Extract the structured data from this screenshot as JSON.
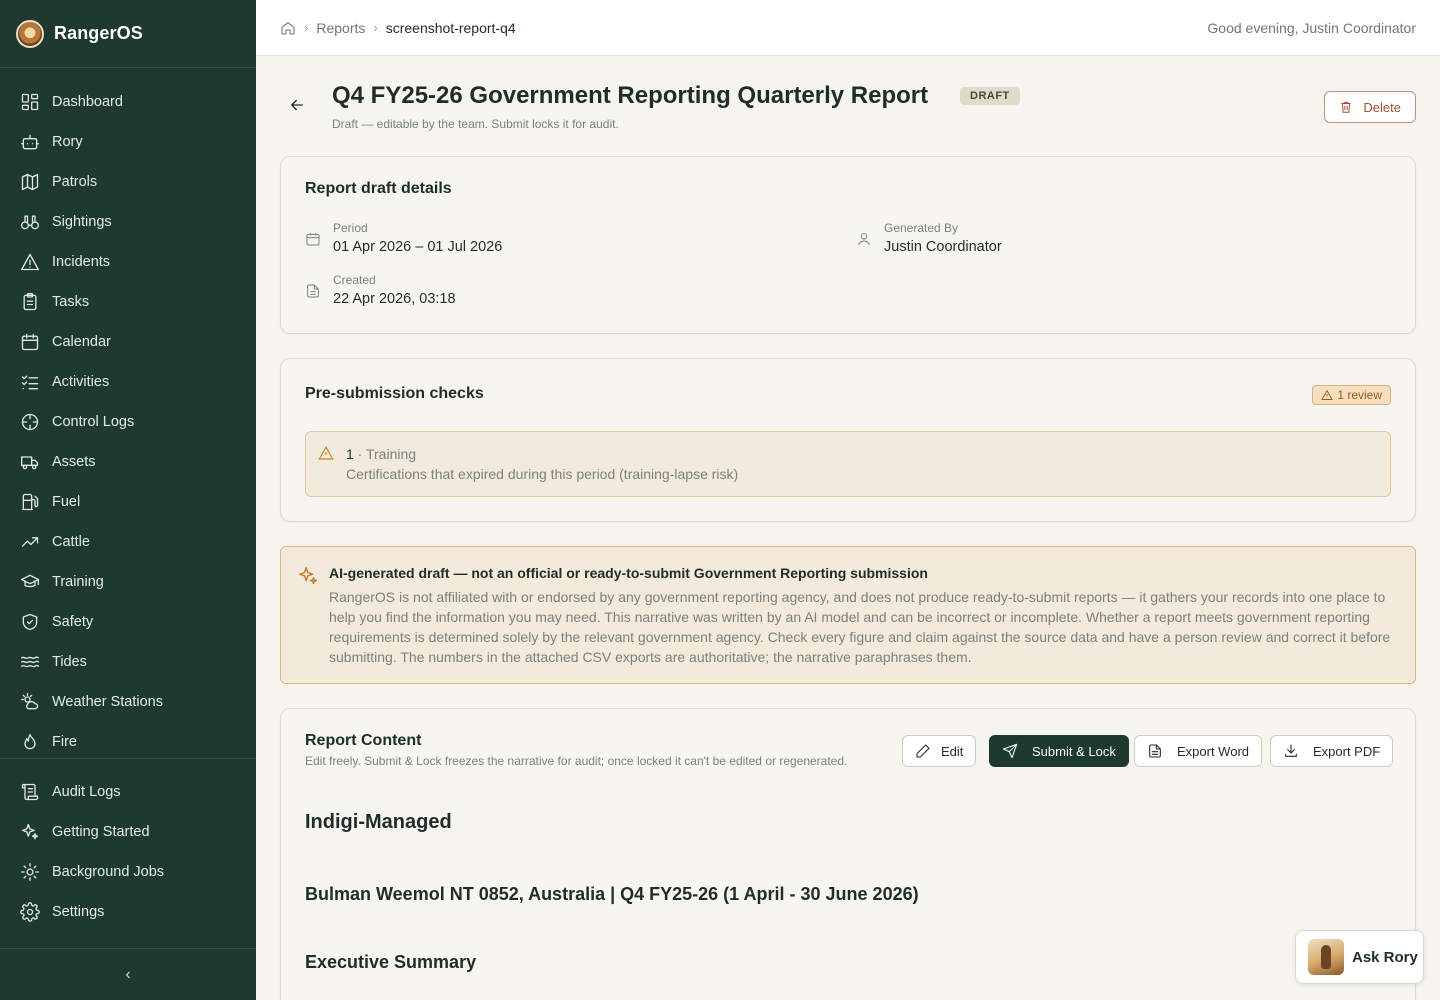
{
  "app": {
    "name": "RangerOS"
  },
  "sidebar": {
    "items": [
      {
        "label": "Dashboard",
        "icon": "dashboard-icon"
      },
      {
        "label": "Rory",
        "icon": "bot-icon"
      },
      {
        "label": "Patrols",
        "icon": "map-icon"
      },
      {
        "label": "Sightings",
        "icon": "binoculars-icon"
      },
      {
        "label": "Incidents",
        "icon": "alert-triangle-icon"
      },
      {
        "label": "Tasks",
        "icon": "clipboard-icon"
      },
      {
        "label": "Calendar",
        "icon": "calendar-icon"
      },
      {
        "label": "Activities",
        "icon": "list-checks-icon"
      },
      {
        "label": "Control Logs",
        "icon": "crosshair-icon"
      },
      {
        "label": "Assets",
        "icon": "truck-icon"
      },
      {
        "label": "Fuel",
        "icon": "fuel-icon"
      },
      {
        "label": "Cattle",
        "icon": "trending-up-icon"
      },
      {
        "label": "Training",
        "icon": "graduation-cap-icon"
      },
      {
        "label": "Safety",
        "icon": "shield-check-icon"
      },
      {
        "label": "Tides",
        "icon": "waves-icon"
      },
      {
        "label": "Weather Stations",
        "icon": "sun-cloud-icon"
      },
      {
        "label": "Fire",
        "icon": "flame-icon"
      }
    ],
    "bottom_items": [
      {
        "label": "Audit Logs",
        "icon": "scroll-icon"
      },
      {
        "label": "Getting Started",
        "icon": "sparkles-icon"
      },
      {
        "label": "Background Jobs",
        "icon": "cog-icon"
      },
      {
        "label": "Settings",
        "icon": "settings-icon"
      }
    ],
    "collapse_glyph": "‹"
  },
  "topbar": {
    "breadcrumb": [
      "Reports",
      "screenshot-report-q4"
    ],
    "greeting": "Good evening, Justin Coordinator"
  },
  "page": {
    "title": "Q4 FY25-26 Government Reporting Quarterly Report",
    "status_badge": "DRAFT",
    "subtitle": "Draft — editable by the team. Submit locks it for audit.",
    "delete_label": "Delete"
  },
  "details": {
    "title": "Report draft details",
    "period_label": "Period",
    "period_value": "01 Apr 2026 – 01 Jul 2026",
    "generated_label": "Generated By",
    "generated_value": "Justin Coordinator",
    "created_label": "Created",
    "created_value": "22 Apr 2026, 03:18"
  },
  "checks": {
    "title": "Pre-submission checks",
    "badge": "1 review",
    "item_count": "1",
    "item_category": " · Training",
    "item_desc": "Certifications that expired during this period (training-lapse risk)"
  },
  "ai_notice": {
    "title": "AI-generated draft — not an official or ready-to-submit Government Reporting submission",
    "body": "RangerOS is not affiliated with or endorsed by any government reporting agency, and does not produce ready-to-submit reports — it gathers your records into one place to help you find the information you may need. This narrative was written by an AI model and can be incorrect or incomplete. Whether a report meets government reporting requirements is determined solely by the relevant government agency. Check every figure and claim against the source data and have a person review and correct it before submitting. The numbers in the attached CSV exports are authoritative; the narrative paraphrases them."
  },
  "content": {
    "title": "Report Content",
    "subtitle": "Edit freely. Submit & Lock freezes the narrative for audit; once locked it can't be edited or regenerated.",
    "buttons": {
      "edit": "Edit",
      "submit": "Submit & Lock",
      "export_word": "Export Word",
      "export_pdf": "Export PDF"
    },
    "heading1": "Indigi-Managed",
    "heading2": "Bulman Weemol NT 0852, Australia | Q4 FY25-26 (1 April - 30 June 2026)",
    "heading3": "Executive Summary"
  },
  "assistant": {
    "label": "Ask Rory"
  },
  "colors": {
    "sidebar_bg": "#1d3a2c",
    "accent": "#1d3a2c",
    "warning": "#c8851f",
    "danger": "#a2512b"
  }
}
